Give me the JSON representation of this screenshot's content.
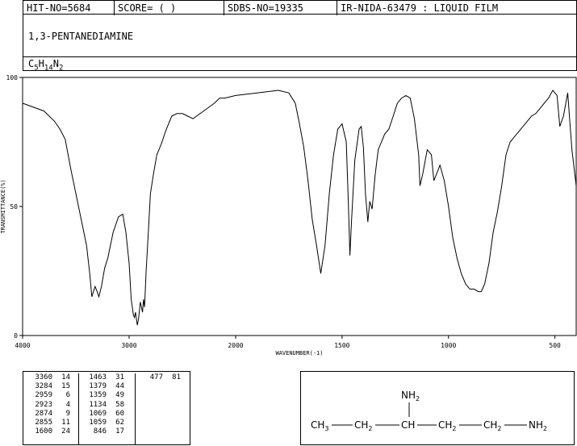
{
  "header": {
    "hit_no": "HIT-NO=5684",
    "score": "SCORE=  (   )",
    "sdbs_no": "SDBS-NO=19335",
    "method": "IR-NIDA-63479 : LIQUID FILM"
  },
  "compound": {
    "name": "1,3-PENTANEDIAMINE",
    "formula": {
      "c": "C",
      "c_n": "5",
      "h": "H",
      "h_n": "14",
      "n": "N",
      "n_n": "2"
    }
  },
  "structure": {
    "nh2_top": "NH2",
    "chain": [
      "CH3",
      "CH2",
      "CH",
      "CH2",
      "CH2",
      "NH2"
    ]
  },
  "peaks": [
    [
      [
        "3360",
        "14"
      ],
      [
        "3284",
        "15"
      ],
      [
        "2959",
        "6"
      ],
      [
        "2923",
        "4"
      ],
      [
        "2874",
        "9"
      ],
      [
        "2855",
        "11"
      ],
      [
        "1600",
        "24"
      ]
    ],
    [
      [
        "1463",
        "31"
      ],
      [
        "1379",
        "44"
      ],
      [
        "1359",
        "49"
      ],
      [
        "1134",
        "58"
      ],
      [
        "1069",
        "60"
      ],
      [
        "1059",
        "62"
      ],
      [
        "846",
        "17"
      ]
    ],
    [
      [
        "477",
        "81"
      ]
    ]
  ],
  "chart_data": {
    "type": "line",
    "title": "",
    "xlabel": "WAVENUMBER(-1)",
    "ylabel": "TRANSMITTANCE(%)",
    "xlim": [
      4000,
      400
    ],
    "ylim": [
      0,
      100
    ],
    "xticks": [
      "4000",
      "3000",
      "2000",
      "1500",
      "1000",
      "500"
    ],
    "xtick_values": [
      4000,
      3000,
      2000,
      1500,
      1000,
      500
    ],
    "yticks": [
      "0",
      "50",
      "100"
    ],
    "ytick_values": [
      0,
      50,
      100
    ],
    "grid": false,
    "series": [
      {
        "x": [
          4000,
          3800,
          3700,
          3650,
          3600,
          3550,
          3500,
          3450,
          3400,
          3370,
          3350,
          3320,
          3300,
          3284,
          3260,
          3230,
          3200,
          3150,
          3100,
          3060,
          3030,
          3000,
          2980,
          2960,
          2950,
          2940,
          2930,
          2923,
          2910,
          2895,
          2874,
          2865,
          2855,
          2840,
          2820,
          2800,
          2770,
          2740,
          2700,
          2650,
          2600,
          2550,
          2500,
          2450,
          2400,
          2300,
          2200,
          2150,
          2100,
          2000,
          1900,
          1800,
          1750,
          1720,
          1700,
          1680,
          1660,
          1640,
          1620,
          1600,
          1580,
          1560,
          1540,
          1520,
          1500,
          1480,
          1470,
          1463,
          1455,
          1440,
          1420,
          1410,
          1400,
          1390,
          1379,
          1370,
          1359,
          1345,
          1330,
          1310,
          1300,
          1280,
          1260,
          1240,
          1220,
          1200,
          1180,
          1160,
          1140,
          1134,
          1120,
          1100,
          1080,
          1069,
          1059,
          1040,
          1020,
          1000,
          980,
          960,
          940,
          920,
          900,
          880,
          860,
          846,
          830,
          810,
          790,
          770,
          750,
          730,
          710,
          690,
          670,
          650,
          630,
          610,
          590,
          570,
          550,
          530,
          510,
          490,
          477,
          460,
          440,
          420,
          400
        ],
        "y": [
          90,
          87,
          83,
          80,
          76,
          65,
          55,
          45,
          35,
          24,
          15,
          19,
          17,
          15,
          19,
          26,
          30,
          40,
          46,
          47,
          40,
          28,
          14,
          8,
          7,
          9,
          6,
          4,
          7,
          13,
          9,
          14,
          11,
          25,
          40,
          55,
          63,
          70,
          74,
          80,
          85,
          86,
          86,
          85,
          84,
          87,
          90,
          92,
          92,
          93,
          94,
          95,
          94,
          90,
          82,
          73,
          60,
          45,
          35,
          24,
          35,
          55,
          70,
          80,
          82,
          75,
          50,
          31,
          45,
          68,
          80,
          81,
          73,
          55,
          44,
          52,
          49,
          62,
          72,
          76,
          78,
          80,
          85,
          90,
          92,
          93,
          92,
          84,
          70,
          58,
          63,
          72,
          70,
          60,
          62,
          66,
          60,
          50,
          38,
          30,
          24,
          20,
          18,
          18,
          17,
          17,
          20,
          28,
          40,
          48,
          58,
          70,
          75,
          77,
          79,
          81,
          83,
          85,
          86,
          88,
          90,
          92,
          95,
          93,
          81,
          85,
          94,
          72,
          58
        ]
      }
    ]
  }
}
